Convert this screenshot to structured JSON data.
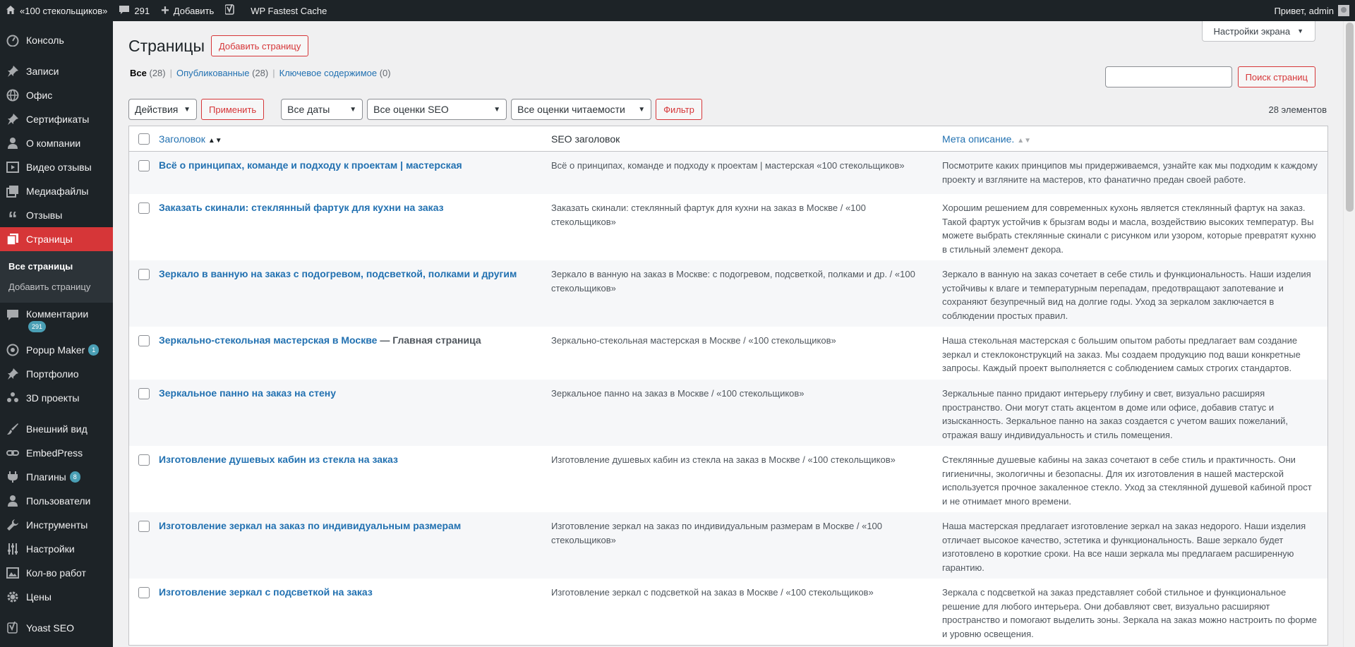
{
  "adminbar": {
    "site_name": "«100 стекольщиков»",
    "comments_count": "291",
    "add_label": "Добавить",
    "cache_label": "WP Fastest Cache",
    "greeting": "Привет, admin"
  },
  "sidebar": {
    "items": [
      {
        "label": "Консоль",
        "icon": "dashboard-icon"
      },
      {
        "label": "Записи",
        "icon": "pin-icon"
      },
      {
        "label": "Офис",
        "icon": "globe-icon"
      },
      {
        "label": "Сертификаты",
        "icon": "pin-icon"
      },
      {
        "label": "О компании",
        "icon": "person-icon"
      },
      {
        "label": "Видео отзывы",
        "icon": "video-icon"
      },
      {
        "label": "Медиафайлы",
        "icon": "media-icon"
      },
      {
        "label": "Отзывы",
        "icon": "quote-icon"
      },
      {
        "label": "Страницы",
        "icon": "pages-icon"
      },
      {
        "label": "Комментарии",
        "icon": "comment-icon",
        "badge": "291"
      },
      {
        "label": "Popup Maker",
        "icon": "popup-icon",
        "badge": "1"
      },
      {
        "label": "Портфолио",
        "icon": "pin-icon"
      },
      {
        "label": "3D проекты",
        "icon": "group-icon"
      },
      {
        "label": "Внешний вид",
        "icon": "brush-icon"
      },
      {
        "label": "EmbedPress",
        "icon": "link-icon"
      },
      {
        "label": "Плагины",
        "icon": "plugin-icon",
        "badge": "8"
      },
      {
        "label": "Пользователи",
        "icon": "person-icon"
      },
      {
        "label": "Инструменты",
        "icon": "wrench-icon"
      },
      {
        "label": "Настройки",
        "icon": "settings-icon"
      },
      {
        "label": "Кол-во работ",
        "icon": "image-icon"
      },
      {
        "label": "Цены",
        "icon": "gear-icon"
      },
      {
        "label": "Yoast SEO",
        "icon": "yoast-icon"
      }
    ],
    "submenu": [
      "Все страницы",
      "Добавить страницу"
    ]
  },
  "screen_options_label": "Настройки экрана",
  "page": {
    "title": "Страницы",
    "add_button": "Добавить страницу"
  },
  "filters": {
    "all_label": "Все",
    "all_count": "(28)",
    "published_label": "Опубликованные",
    "published_count": "(28)",
    "cornerstone_label": "Ключевое содержимое",
    "cornerstone_count": "(0)",
    "sep": "|"
  },
  "search": {
    "button": "Поиск страниц"
  },
  "tablenav": {
    "bulk_actions": "Действия",
    "apply": "Применить",
    "dates": "Все даты",
    "seo": "Все оценки SEO",
    "readability": "Все оценки читаемости",
    "filter": "Фильтр",
    "count": "28 элементов"
  },
  "table": {
    "headers": {
      "title": "Заголовок",
      "seo": "SEO заголовок",
      "meta": "Мета описание."
    },
    "rows": [
      {
        "title": "Всё о принципах, команде и подходу к проектам | мастерская",
        "suffix": "",
        "seo": "Всё о принципах, команде и подходу к проектам | мастерская «100 стекольщиков»",
        "meta": "Посмотрите каких принципов мы придерживаемся, узнайте как мы подходим к каждому проекту и взгляните на мастеров, кто фанатично предан своей работе."
      },
      {
        "title": "Заказать скинали: стеклянный фартук для кухни на заказ",
        "suffix": "",
        "seo": "Заказать скинали: стеклянный фартук для кухни на заказ в Москве / «100 стекольщиков»",
        "meta": "Хорошим решением для современных кухонь является стеклянный фартук на заказ. Такой фартук устойчив к брызгам воды и масла, воздействию высоких температур. Вы можете выбрать стеклянные скинали с рисунком или узором, которые превратят кухню в стильный элемент декора."
      },
      {
        "title": "Зеркало в ванную на заказ с подогревом, подсветкой, полками и другим",
        "suffix": "",
        "seo": "Зеркало в ванную на заказ в Москве: с подогревом, подсветкой, полками и др. / «100 стекольщиков»",
        "meta": "Зеркало в ванную на заказ сочетает в себе стиль и функциональность. Наши изделия устойчивы к влаге и температурным перепадам, предотвращают запотевание и сохраняют безупречный вид на долгие годы. Уход за зеркалом заключается в соблюдении простых правил."
      },
      {
        "title": "Зеркально-стекольная мастерская в Москве",
        "suffix": " — Главная страница",
        "seo": "Зеркально-стекольная мастерская в Москве / «100 стекольщиков»",
        "meta": "Наша стекольная мастерская с большим опытом работы предлагает вам создание зеркал и стеклоконструкций на заказ. Мы создаем продукцию под ваши конкретные запросы. Каждый проект выполняется с соблюдением самых строгих стандартов."
      },
      {
        "title": "Зеркальное панно на заказ на стену",
        "suffix": "",
        "seo": "Зеркальное панно на заказ в Москве / «100 стекольщиков»",
        "meta": "Зеркальные панно придают интерьеру глубину и свет, визуально расширяя пространство. Они могут стать акцентом в доме или офисе, добавив статус и изысканность. Зеркальное панно на заказ создается с учетом ваших пожеланий, отражая вашу индивидуальность и стиль помещения."
      },
      {
        "title": "Изготовление душевых кабин из стекла на заказ",
        "suffix": "",
        "seo": "Изготовление душевых кабин из стекла на заказ в Москве / «100 стекольщиков»",
        "meta": "Стеклянные душевые кабины на заказ сочетают в себе стиль и практичность. Они гигиеничны, экологичны и безопасны. Для их изготовления в нашей мастерской используется прочное закаленное стекло. Уход за стеклянной душевой кабиной прост и не отнимает много времени."
      },
      {
        "title": "Изготовление зеркал на заказ по индивидуальным размерам",
        "suffix": "",
        "seo": "Изготовление зеркал на заказ по индивидуальным размерам в Москве / «100 стекольщиков»",
        "meta": "Наша мастерская предлагает изготовление зеркал на заказ недорого. Наши изделия отличает высокое качество, эстетика и функциональность. Ваше зеркало будет изготовлено в короткие сроки. На все наши зеркала мы предлагаем расширенную гарантию."
      },
      {
        "title": "Изготовление зеркал с подсветкой на заказ",
        "suffix": "",
        "seo": "Изготовление зеркал с подсветкой на заказ в Москве / «100 стекольщиков»",
        "meta": "Зеркала с подсветкой на заказ представляет собой стильное и функциональное решение для любого интерьера. Они добавляют свет, визуально расширяют пространство и помогают выделить зоны. Зеркала на заказ можно настроить по форме и уровню освещения."
      }
    ]
  }
}
